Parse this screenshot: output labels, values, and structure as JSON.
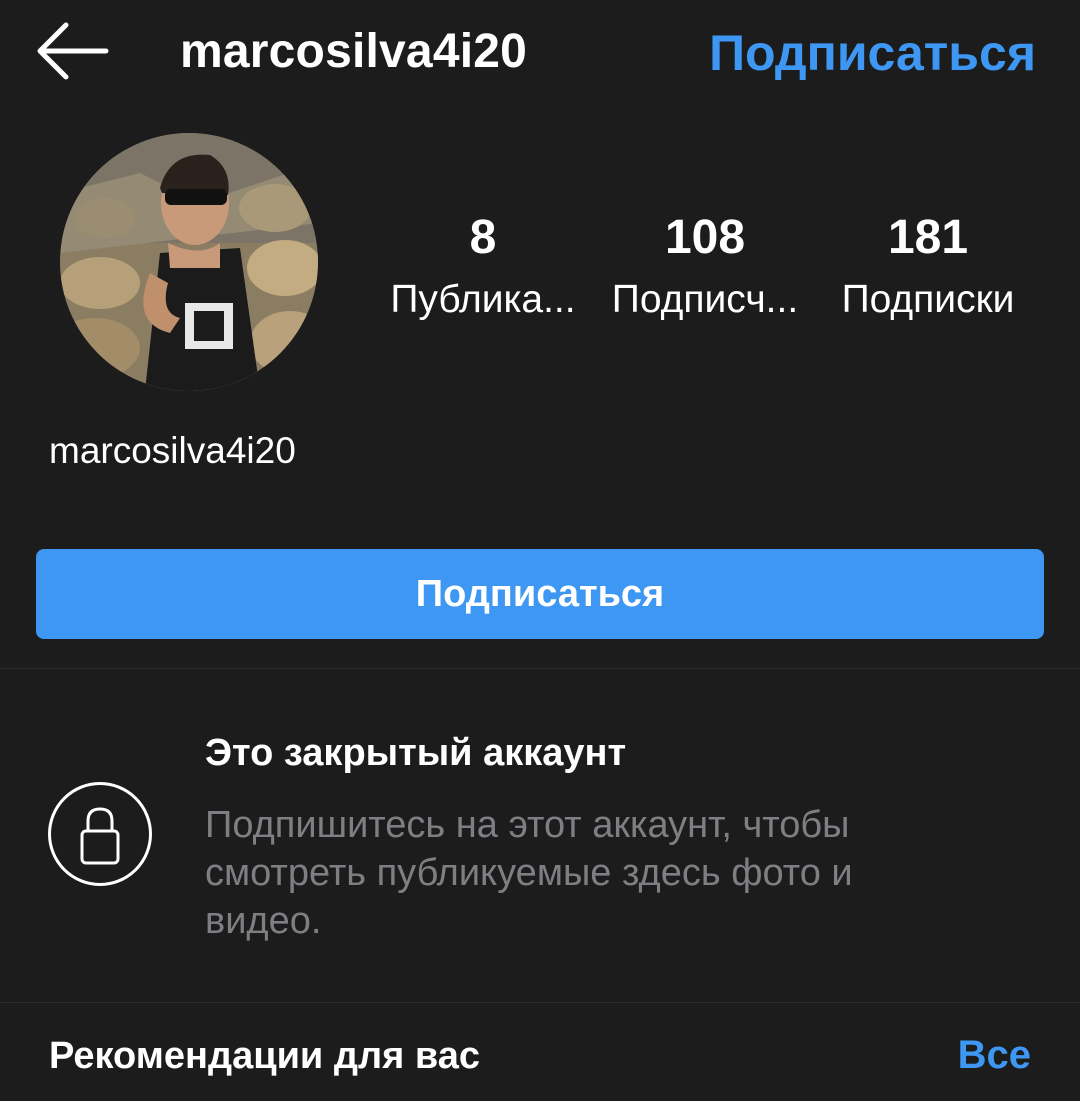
{
  "header": {
    "back_icon": "arrow-left-icon",
    "username": "marcosilva4i20",
    "follow_label": "Подписаться"
  },
  "profile": {
    "avatar_icon": "profile-photo",
    "display_name": "marcosilva4i20",
    "stats": [
      {
        "value": "8",
        "label": "Публика..."
      },
      {
        "value": "108",
        "label": "Подписч..."
      },
      {
        "value": "181",
        "label": "Подписки"
      }
    ],
    "follow_button_label": "Подписаться"
  },
  "private": {
    "icon": "lock-icon",
    "title": "Это закрытый аккаунт",
    "description": "Подпишитесь на этот аккаунт, чтобы смотреть публикуемые здесь фото и видео."
  },
  "recommendations": {
    "title": "Рекомендации для вас",
    "see_all_label": "Все"
  },
  "colors": {
    "background": "#1c1c1d",
    "accent": "#3d97f3",
    "text": "#ffffff",
    "muted_text": "#7f7f83"
  }
}
